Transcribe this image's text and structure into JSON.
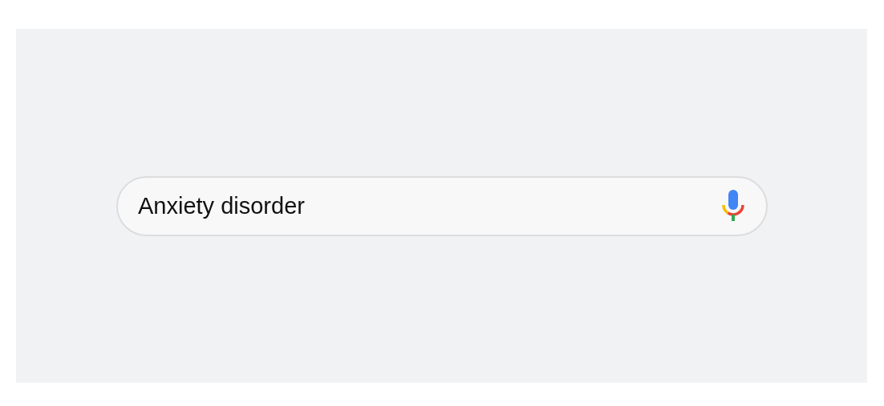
{
  "search": {
    "value": "Anxiety disorder"
  }
}
